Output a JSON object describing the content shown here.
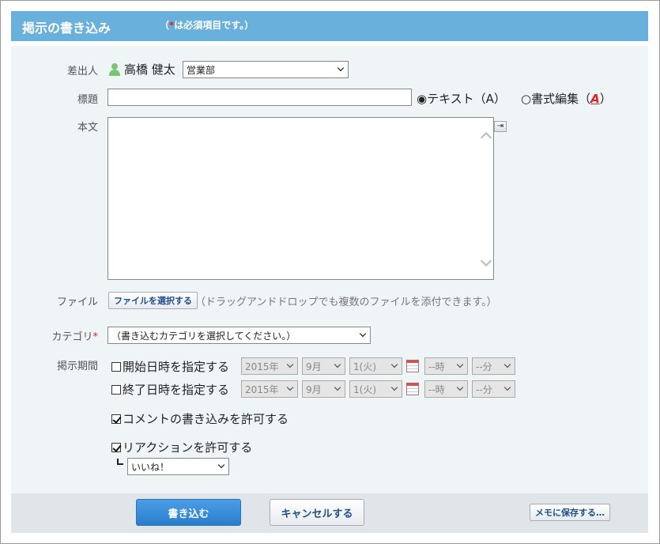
{
  "header": {
    "title": "掲示の書き込み",
    "note_open": "（",
    "note_star": "*",
    "note_rest": "は必須項目です。）"
  },
  "form": {
    "sender": {
      "label": "差出人",
      "user_name": "高橋 健太",
      "department": "営業部"
    },
    "subject": {
      "label": "標題",
      "value": "",
      "format_text": "◉テキスト（A）",
      "format_rich_prefix": "○書式編集（",
      "format_rich_A": "A",
      "format_rich_suffix": "）"
    },
    "body": {
      "label": "本文",
      "value": ""
    },
    "file": {
      "label": "ファイル",
      "button": "ファイルを選択する",
      "hint": "（ドラッグアンドドロップでも複数のファイルを添付できます。）"
    },
    "category": {
      "label": "カテゴリ",
      "required_mark": "*",
      "selected": "（書き込むカテゴリを選択してください。）"
    },
    "period": {
      "label": "掲示期間",
      "start": {
        "checkbox_label": "開始日時を指定する",
        "year": "2015年",
        "month": "9月",
        "day": "1(火)",
        "hour": "--時",
        "minute": "--分"
      },
      "end": {
        "checkbox_label": "終了日時を指定する",
        "year": "2015年",
        "month": "9月",
        "day": "1(火)",
        "hour": "--時",
        "minute": "--分"
      }
    },
    "allow_comments": {
      "label": "コメントの書き込みを許可する",
      "checked": true
    },
    "allow_reactions": {
      "label": "リアクションを許可する",
      "checked": true,
      "reaction_type": "いいね！"
    }
  },
  "footer": {
    "submit": "書き込む",
    "cancel": "キャンセルする",
    "save_memo": "メモに保存する…"
  },
  "colors": {
    "header_bg": "#6ab0dc",
    "primary_btn": "#2a7dcc",
    "required": "#d8232a"
  }
}
